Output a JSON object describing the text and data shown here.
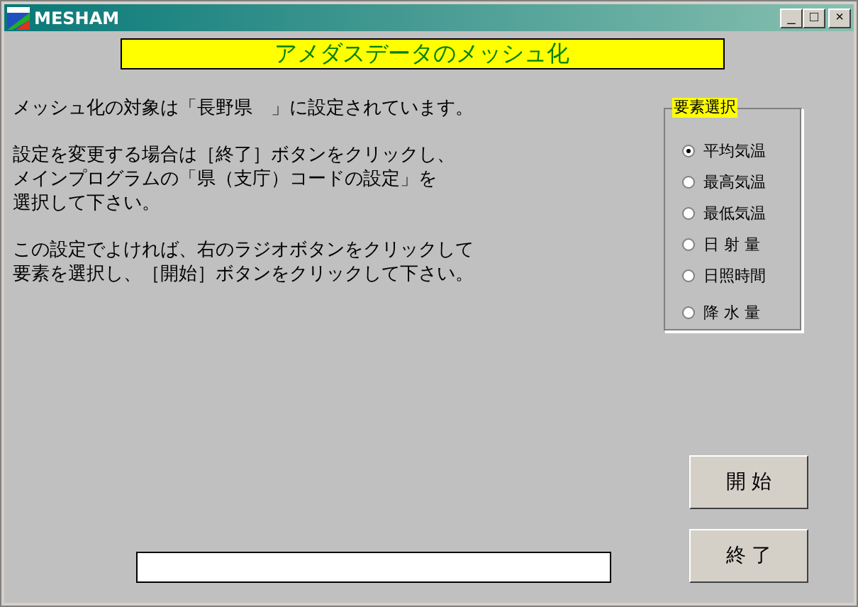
{
  "window": {
    "title": "MESHAM",
    "controls": [
      "_",
      "□",
      "×"
    ]
  },
  "heading": "アメダスデータのメッシュ化",
  "paragraphs": [
    {
      "lines": [
        "メッシュ化の対象は「長野県　」に設定されています。"
      ]
    },
    {
      "lines": [
        "設定を変更する場合は［終了］ボタンをクリックし、",
        "メインプログラムの「県（支庁）コードの設定」を",
        "選択して下さい。"
      ]
    },
    {
      "lines": [
        "この設定でよければ、右のラジオボタンをクリックして",
        "要素を選択し、［開始］ボタンをクリックして下さい。"
      ]
    }
  ],
  "element_group": {
    "title": "要素選択",
    "options": [
      {
        "label": "平均気温",
        "selected": true
      },
      {
        "label": "最高気温",
        "selected": false
      },
      {
        "label": "最低気温",
        "selected": false
      },
      {
        "label": "日 射 量",
        "selected": false
      },
      {
        "label": "日照時間",
        "selected": false
      },
      {
        "label": "降 水 量",
        "selected": false
      }
    ]
  },
  "buttons": [
    "開 始",
    "終 了"
  ]
}
